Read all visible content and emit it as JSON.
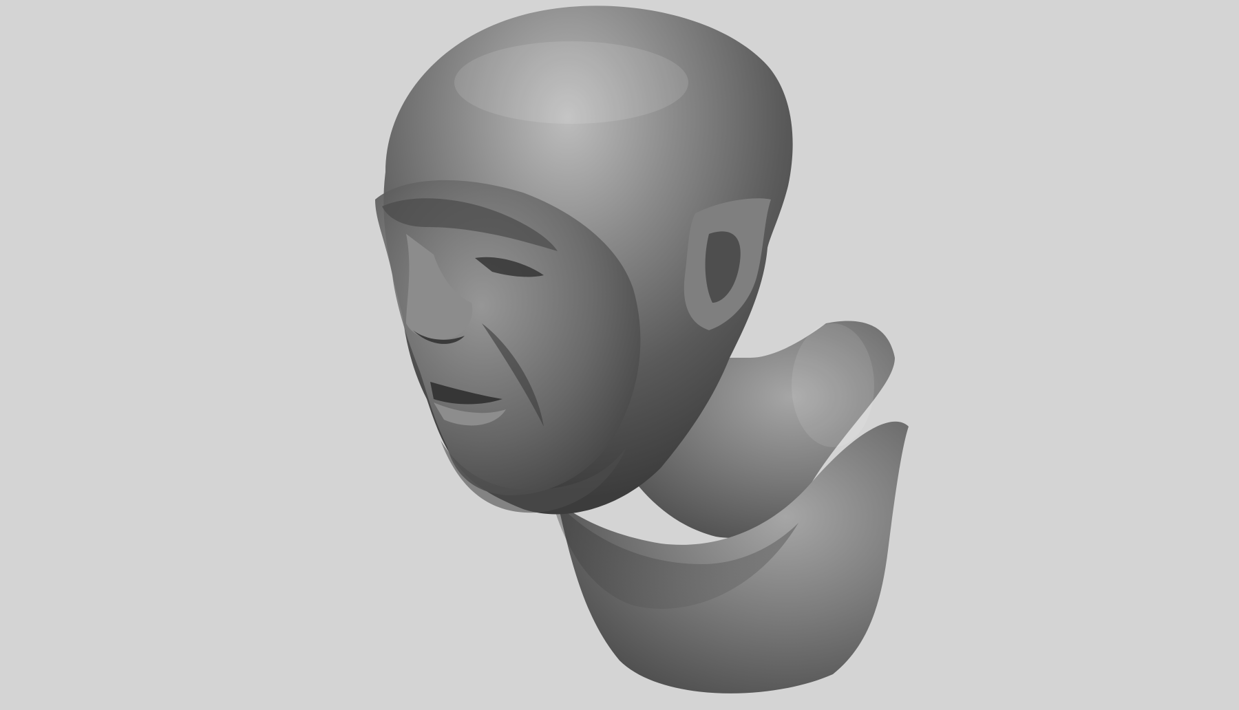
{
  "viewport": {
    "background_color": "#d4d4d4",
    "subject": "sculpt-bust",
    "material_color": "#6e6e6e"
  }
}
